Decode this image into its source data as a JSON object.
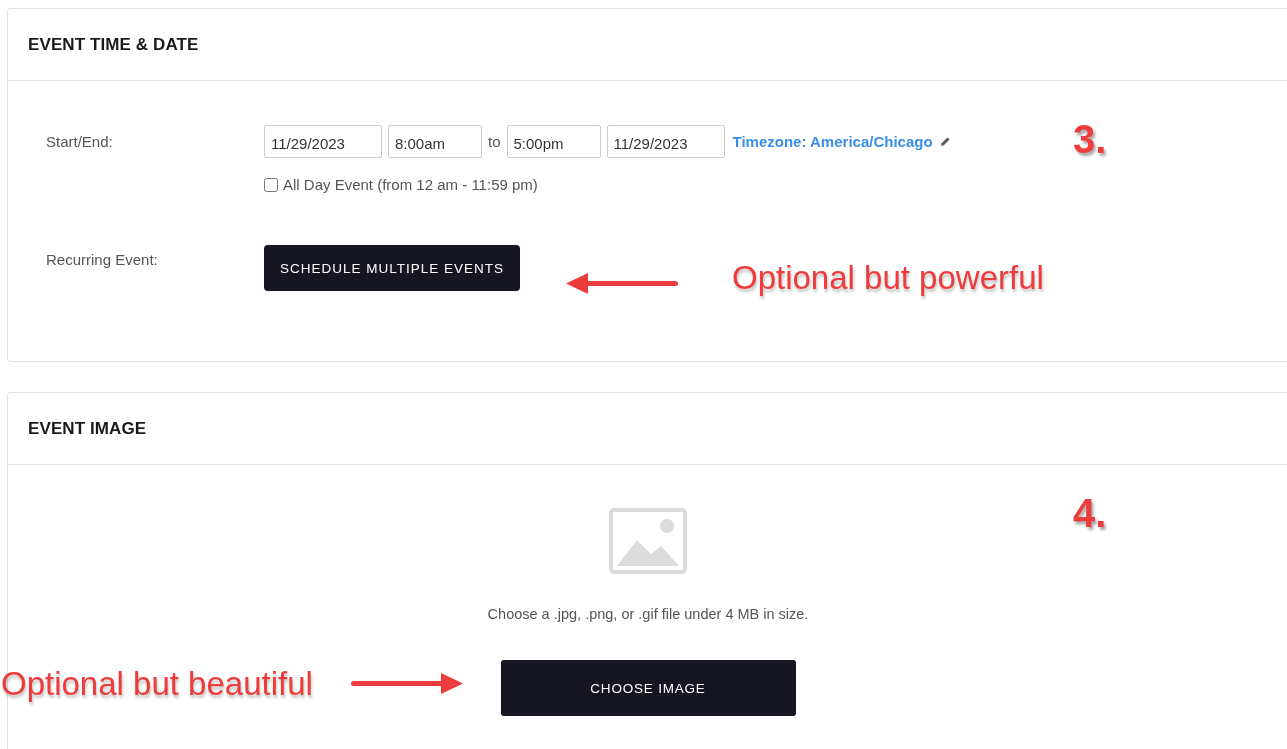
{
  "event_time_date": {
    "title": "EVENT TIME & DATE",
    "start_end_label": "Start/End:",
    "start_date": "11/29/2023",
    "start_time": "8:00am",
    "to_label": "to",
    "end_time": "5:00pm",
    "end_date": "11/29/2023",
    "timezone_link": "Timezone: America/Chicago",
    "all_day": {
      "label": "All Day Event (from 12 am - 11:59 pm)",
      "checked": false
    },
    "recurring_label": "Recurring Event:",
    "schedule_button": "SCHEDULE MULTIPLE EVENTS",
    "annotations": [
      {
        "kind": "step",
        "text": "3."
      },
      {
        "kind": "callout",
        "text": "Optional but powerful"
      },
      {
        "kind": "leftarrow"
      }
    ]
  },
  "event_image": {
    "title": "EVENT IMAGE",
    "hint": "Choose a .jpg, .png, or .gif file under 4 MB in size.",
    "choose_button": "CHOOSE IMAGE",
    "annotations": [
      {
        "kind": "step",
        "text": "4."
      },
      {
        "kind": "callout",
        "text": "Optional but beautiful"
      },
      {
        "kind": "rightarrow"
      }
    ]
  }
}
